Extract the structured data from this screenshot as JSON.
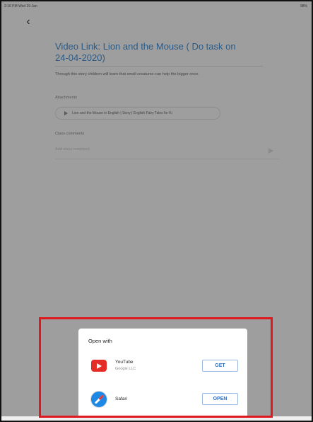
{
  "status_bar": {
    "time": "2:16 PM",
    "date": "Wed 29 Jan",
    "battery": "98%"
  },
  "nav": {
    "back_icon": "chevron-left-icon"
  },
  "post": {
    "title": "Video Link: Lion and the Mouse ( Do task on 24-04-2020)",
    "description": "Through this story children will learn that small creatures can help the bigger once.",
    "attachments_heading": "Attachments",
    "attachment_label": "Lion and the Mouse in English | Story | English Fairy Tales for Ki",
    "comments_heading": "Class comments",
    "comment_placeholder": "Add class comment"
  },
  "sheet": {
    "title": "Open with",
    "apps": [
      {
        "name": "YouTube",
        "subtitle": "Google LLC",
        "action": "GET",
        "icon": "youtube-icon"
      },
      {
        "name": "Safari",
        "subtitle": "",
        "action": "OPEN",
        "icon": "safari-icon"
      }
    ]
  },
  "colors": {
    "overlay": "#9e9e9e",
    "title_link": "#2a5a88",
    "highlight_border": "#e0191e",
    "button_text": "#2f6fbf",
    "youtube_red": "#e52d27",
    "safari_blue": "#1e88e5"
  }
}
